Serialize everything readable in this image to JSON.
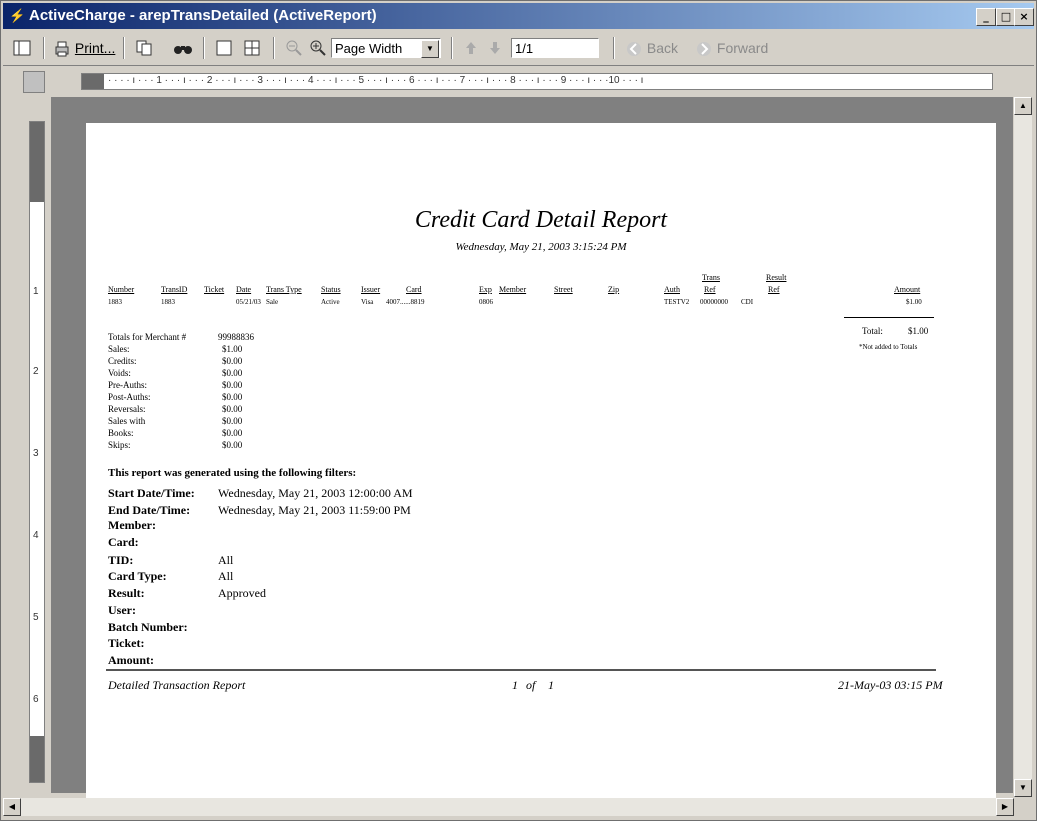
{
  "window": {
    "title": "ActiveCharge - arepTransDetailed (ActiveReport)",
    "title_icon": "app-icon",
    "controls": {
      "minimize": "_",
      "maximize": "□",
      "close": "×"
    }
  },
  "toolbar": {
    "print_label": "Print...",
    "zoom_value": "Page Width",
    "page_value": "1/1",
    "back_label": "Back",
    "forward_label": "Forward"
  },
  "ruler": {
    "ticks": "· · · · ı · · · 1 · · · ı · · · 2 · · · ı · · · 3 · · · ı · · · 4 · · · ı · · · 5 · · · ı · · · 6 · · · ı · · · 7 · · · ı · · · 8 · · · ı · · · 9 · · · ı · · ·10 · · · ı"
  },
  "vruler": {
    "marks": [
      "1",
      "2",
      "3",
      "4",
      "5",
      "6"
    ]
  },
  "report": {
    "title": "Credit Card Detail Report",
    "subtitle": "Wednesday, May 21, 2003 3:15:24 PM",
    "columns": {
      "number": "Number",
      "transid": "TransID",
      "ticket": "Ticket",
      "date": "Date",
      "trans_type": "Trans Type",
      "status": "Status",
      "issuer": "Issuer",
      "card": "Card",
      "exp": "Exp",
      "member": "Member",
      "street": "Street",
      "zip": "Zip",
      "auth": "Auth",
      "trans_ref_top": "Trans",
      "trans_ref_bottom": "Ref",
      "result_ref_top": "Result",
      "result_ref_bottom": "Ref",
      "amount": "Amount"
    },
    "row": {
      "number": "1883",
      "transid": "1883",
      "date": "05/21/03",
      "trans_type": "Sale",
      "status": "Active",
      "issuer": "Visa",
      "card": "4007......8819",
      "exp": "0806",
      "auth": "TESTV2",
      "trans_ref": "00000000",
      "result_ref": "CDI",
      "amount": "$1.00"
    },
    "total_label": "Total:",
    "total_value": "$1.00",
    "total_note": "*Not added to Totals",
    "totals_header": "Totals for Merchant #",
    "merchant_no": "99988836",
    "summary": [
      {
        "label": "Sales:",
        "value": "$1.00"
      },
      {
        "label": "Credits:",
        "value": "$0.00"
      },
      {
        "label": "Voids:",
        "value": "$0.00"
      },
      {
        "label": "Pre-Auths:",
        "value": "$0.00"
      },
      {
        "label": "Post-Auths:",
        "value": "$0.00"
      },
      {
        "label": "Reversals:",
        "value": "$0.00"
      },
      {
        "label": "Sales with",
        "value": "$0.00"
      },
      {
        "label": "Books:",
        "value": "$0.00"
      },
      {
        "label": "Skips:",
        "value": "$0.00"
      }
    ],
    "filters_header": "This report was generated using the following filters:",
    "filters": [
      {
        "label": "Start Date/Time:",
        "value": "Wednesday, May 21, 2003  12:00:00 AM"
      },
      {
        "label": "End Date/Time:",
        "value": "Wednesday, May 21, 2003  11:59:00 PM"
      },
      {
        "label": "Member:",
        "value": ""
      },
      {
        "label": "Card:",
        "value": ""
      },
      {
        "label": "TID:",
        "value": "All"
      },
      {
        "label": "Card Type:",
        "value": "All"
      },
      {
        "label": "Result:",
        "value": "Approved"
      },
      {
        "label": "User:",
        "value": ""
      },
      {
        "label": "Batch Number:",
        "value": ""
      },
      {
        "label": "Ticket:",
        "value": ""
      },
      {
        "label": "Amount:",
        "value": ""
      }
    ],
    "footer": {
      "left": "Detailed Transaction Report",
      "page": "1",
      "of": "of",
      "pages": "1",
      "right": "21-May-03 03:15 PM"
    }
  }
}
